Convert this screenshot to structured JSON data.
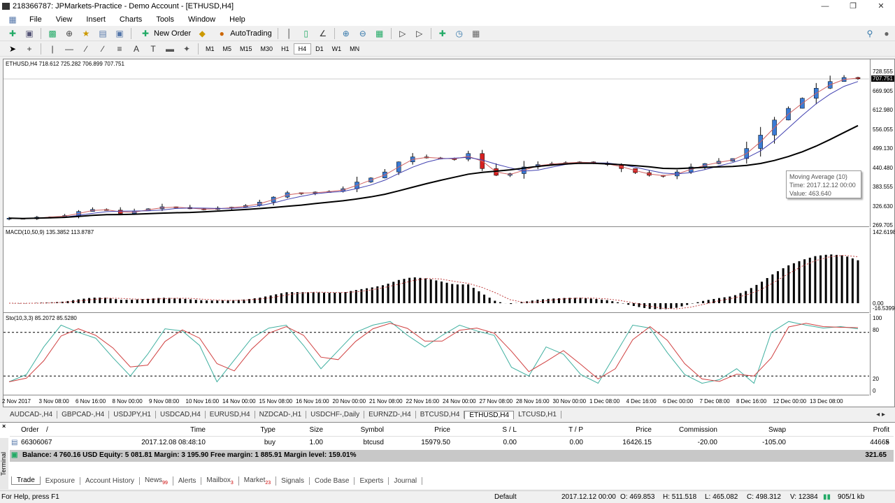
{
  "window": {
    "title": "218366787: JPMarkets-Practice - Demo Account - [ETHUSD,H4]"
  },
  "menu": [
    "File",
    "View",
    "Insert",
    "Charts",
    "Tools",
    "Window",
    "Help"
  ],
  "toolbar": {
    "new_order": "New Order",
    "autotrading": "AutoTrading"
  },
  "timeframes": [
    "M1",
    "M5",
    "M15",
    "M30",
    "H1",
    "H4",
    "D1",
    "W1",
    "MN"
  ],
  "active_timeframe": "H4",
  "chart": {
    "header": "ETHUSD,H4  718.612 725.282 706.899 707.751",
    "price_axis": [
      "728.555",
      "669.905",
      "612.980",
      "556.055",
      "499.130",
      "440.480",
      "383.555",
      "326.630",
      "269.705"
    ],
    "current_price": "707.751",
    "macd_label": "MACD(10,50,9) 135.3852 113.8787",
    "macd_axis": [
      "142.6198",
      "0.00",
      "-16.5399"
    ],
    "stoch_label": "Sto(10,3,3) 85.2072 85.5280",
    "stoch_axis": [
      "100",
      "80",
      "20",
      "0"
    ],
    "time_axis": [
      "2 Nov 2017",
      "3 Nov 08:00",
      "6 Nov 16:00",
      "8 Nov 00:00",
      "9 Nov 08:00",
      "10 Nov 16:00",
      "14 Nov 00:00",
      "15 Nov 08:00",
      "16 Nov 16:00",
      "20 Nov 00:00",
      "21 Nov 08:00",
      "22 Nov 16:00",
      "24 Nov 00:00",
      "27 Nov 08:00",
      "28 Nov 16:00",
      "30 Nov 00:00",
      "1 Dec 08:00",
      "4 Dec 16:00",
      "6 Dec 00:00",
      "7 Dec 08:00",
      "8 Dec 16:00",
      "12 Dec 00:00",
      "13 Dec 08:00"
    ],
    "tooltip": {
      "line1": "Moving Average (10)",
      "line2": "Time: 2017.12.12 00:00",
      "line3": "Value: 463.640"
    },
    "colors": {
      "bull": "#3a7bd5",
      "bear": "#d62020",
      "ma_fast": "#d06060",
      "ma_mid": "#4040b0",
      "ma_slow": "#000000",
      "stoch_main": "#40b0a0",
      "stoch_signal": "#d04040"
    }
  },
  "chart_data": {
    "type": "candlestick",
    "symbol": "ETHUSD",
    "timeframe": "H4",
    "ylim": [
      269.705,
      728.555
    ],
    "closes": [
      292,
      290,
      295,
      296,
      300,
      312,
      318,
      316,
      306,
      314,
      320,
      326,
      324,
      320,
      318,
      322,
      325,
      330,
      340,
      355,
      368,
      366,
      370,
      372,
      380,
      400,
      412,
      430,
      460,
      475,
      472,
      470,
      468,
      485,
      440,
      420,
      425,
      445,
      452,
      455,
      458,
      460,
      456,
      452,
      440,
      428,
      420,
      418,
      430,
      445,
      455,
      462,
      470,
      500,
      540,
      585,
      620,
      650,
      680,
      700,
      712,
      708
    ],
    "macd_histogram_range": [
      -16.5399,
      142.6198
    ],
    "stochastic": [
      12,
      22,
      60,
      90,
      80,
      72,
      45,
      20,
      50,
      85,
      82,
      62,
      12,
      42,
      72,
      86,
      90,
      62,
      30,
      55,
      80,
      90,
      95,
      76,
      60,
      76,
      90,
      82,
      76,
      32,
      20,
      60,
      50,
      22,
      10,
      50,
      90,
      86,
      52,
      22,
      10,
      15,
      30,
      10,
      80,
      95,
      90,
      86,
      88,
      85
    ]
  },
  "chart_tabs": [
    "AUDCAD-,H4",
    "GBPCAD-,H4",
    "USDJPY,H1",
    "USDCAD,H4",
    "EURUSD,H4",
    "NZDCAD-,H1",
    "USDCHF-,Daily",
    "EURNZD-,H4",
    "BTCUSD,H4",
    "ETHUSD,H4",
    "LTCUSD,H1"
  ],
  "active_chart_tab": "ETHUSD,H4",
  "terminal": {
    "side_label": "Terminal",
    "columns": [
      "Order",
      "Time",
      "Type",
      "Size",
      "Symbol",
      "Price",
      "S / L",
      "T / P",
      "Price",
      "Commission",
      "Swap",
      "Profit"
    ],
    "sort_indicator": "/",
    "orders": [
      {
        "order": "66306067",
        "time": "2017.12.08 08:48:10",
        "type": "buy",
        "size": "1.00",
        "symbol": "btcusd",
        "price": "15979.50",
        "sl": "0.00",
        "tp": "0.00",
        "cur_price": "16426.15",
        "commission": "-20.00",
        "swap": "-105.00",
        "profit": "44665"
      }
    ],
    "balance": "Balance: 4 760.16 USD  Equity: 5 081.81  Margin: 3 195.90  Free margin: 1 885.91  Margin level: 159.01%",
    "total_profit": "321.65",
    "tabs": [
      {
        "label": "Trade"
      },
      {
        "label": "Exposure"
      },
      {
        "label": "Account History"
      },
      {
        "label": "News",
        "badge": "99"
      },
      {
        "label": "Alerts"
      },
      {
        "label": "Mailbox",
        "badge": "3"
      },
      {
        "label": "Market",
        "badge": "23"
      },
      {
        "label": "Signals"
      },
      {
        "label": "Code Base"
      },
      {
        "label": "Experts"
      },
      {
        "label": "Journal"
      }
    ]
  },
  "status": {
    "help": "For Help, press F1",
    "profile": "Default",
    "time": "2017.12.12 00:00",
    "open": "O: 469.853",
    "high": "H: 511.518",
    "low": "L: 465.082",
    "close": "C: 498.312",
    "volume": "V: 12384",
    "traffic": "905/1 kb"
  }
}
